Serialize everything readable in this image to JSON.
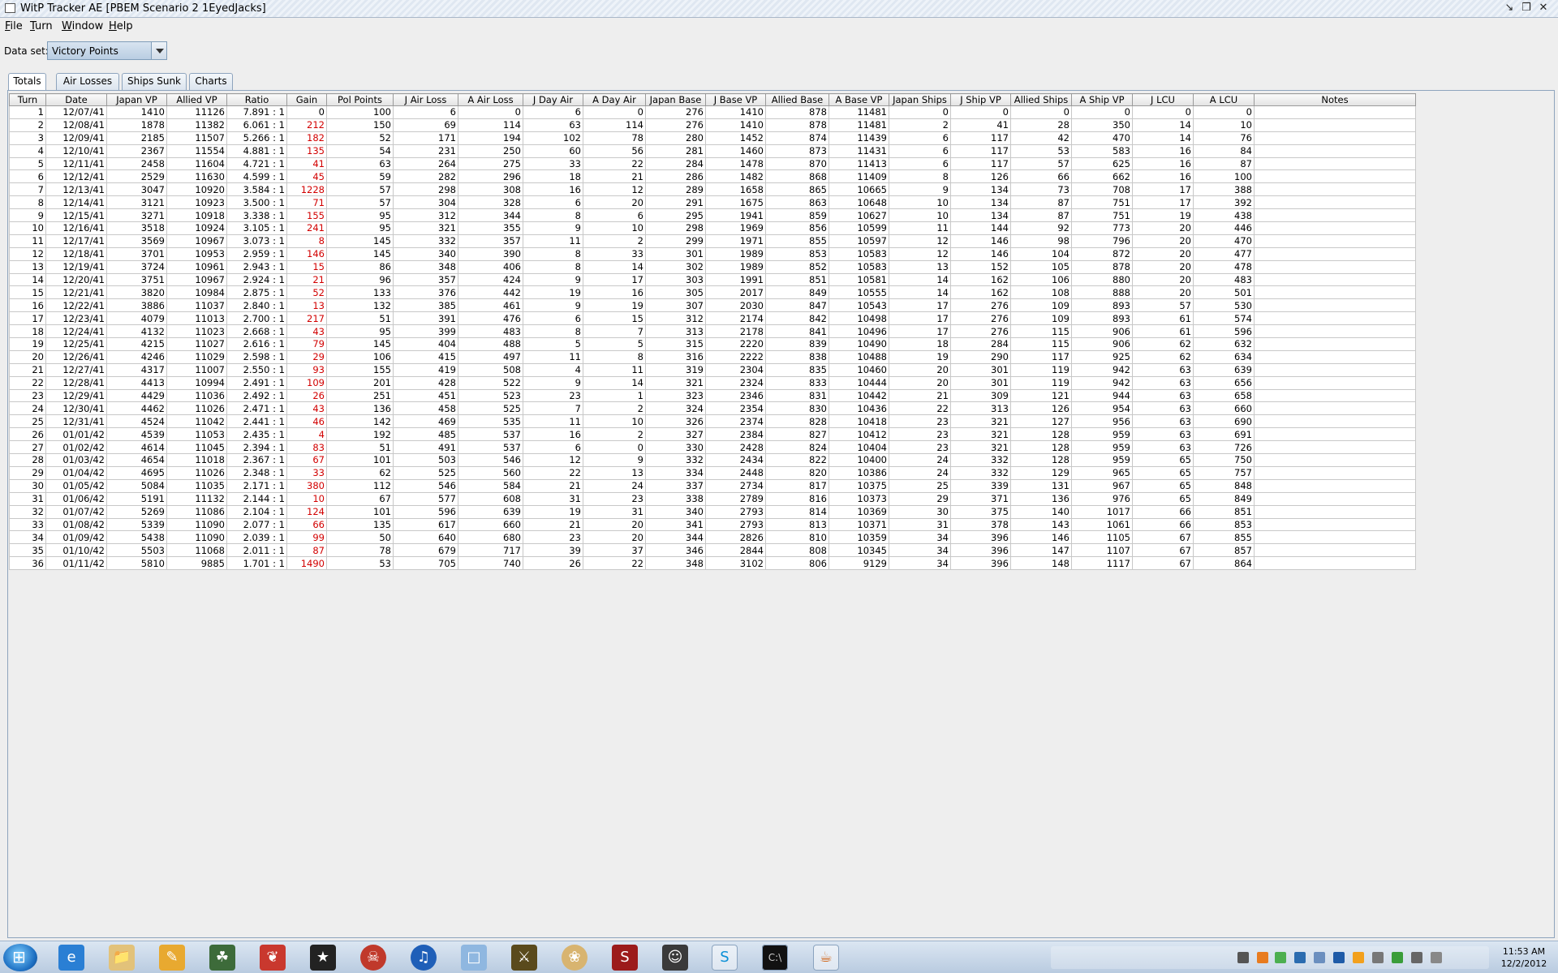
{
  "window": {
    "title": "WitP Tracker AE [PBEM Scenario 2 1EyedJacks]"
  },
  "menu": [
    {
      "hot": "F",
      "rest": "ile"
    },
    {
      "hot": "T",
      "rest": "urn"
    },
    {
      "hot": "W",
      "rest": "indow"
    },
    {
      "hot": "H",
      "rest": "elp"
    }
  ],
  "dataset": {
    "label": "Data set:",
    "value": "Victory Points"
  },
  "tabs": [
    "Totals",
    "Air Losses",
    "Ships Sunk",
    "Charts"
  ],
  "active_tab": "Totals",
  "table": {
    "columns": [
      "Turn",
      "Date",
      "Japan VP",
      "Allied VP",
      "Ratio",
      "Gain",
      "Pol Points",
      "J Air Loss",
      "A Air Loss",
      "J Day Air",
      "A Day Air",
      "Japan Base",
      "J Base VP",
      "Allied Base",
      "A Base VP",
      "Japan Ships",
      "J Ship VP",
      "Allied Ships",
      "A Ship VP",
      "J LCU",
      "A LCU",
      "Notes"
    ],
    "rows": [
      [
        "1",
        "12/07/41",
        "1410",
        "11126",
        "7.891 : 1",
        "0",
        "100",
        "6",
        "0",
        "6",
        "0",
        "276",
        "1410",
        "878",
        "11481",
        "0",
        "0",
        "0",
        "0",
        "0",
        "0",
        ""
      ],
      [
        "2",
        "12/08/41",
        "1878",
        "11382",
        "6.061 : 1",
        "212",
        "150",
        "69",
        "114",
        "63",
        "114",
        "276",
        "1410",
        "878",
        "11481",
        "2",
        "41",
        "28",
        "350",
        "14",
        "10",
        ""
      ],
      [
        "3",
        "12/09/41",
        "2185",
        "11507",
        "5.266 : 1",
        "182",
        "52",
        "171",
        "194",
        "102",
        "78",
        "280",
        "1452",
        "874",
        "11439",
        "6",
        "117",
        "42",
        "470",
        "14",
        "76",
        ""
      ],
      [
        "4",
        "12/10/41",
        "2367",
        "11554",
        "4.881 : 1",
        "135",
        "54",
        "231",
        "250",
        "60",
        "56",
        "281",
        "1460",
        "873",
        "11431",
        "6",
        "117",
        "53",
        "583",
        "16",
        "84",
        ""
      ],
      [
        "5",
        "12/11/41",
        "2458",
        "11604",
        "4.721 : 1",
        "41",
        "63",
        "264",
        "275",
        "33",
        "22",
        "284",
        "1478",
        "870",
        "11413",
        "6",
        "117",
        "57",
        "625",
        "16",
        "87",
        ""
      ],
      [
        "6",
        "12/12/41",
        "2529",
        "11630",
        "4.599 : 1",
        "45",
        "59",
        "282",
        "296",
        "18",
        "21",
        "286",
        "1482",
        "868",
        "11409",
        "8",
        "126",
        "66",
        "662",
        "16",
        "100",
        ""
      ],
      [
        "7",
        "12/13/41",
        "3047",
        "10920",
        "3.584 : 1",
        "1228",
        "57",
        "298",
        "308",
        "16",
        "12",
        "289",
        "1658",
        "865",
        "10665",
        "9",
        "134",
        "73",
        "708",
        "17",
        "388",
        ""
      ],
      [
        "8",
        "12/14/41",
        "3121",
        "10923",
        "3.500 : 1",
        "71",
        "57",
        "304",
        "328",
        "6",
        "20",
        "291",
        "1675",
        "863",
        "10648",
        "10",
        "134",
        "87",
        "751",
        "17",
        "392",
        ""
      ],
      [
        "9",
        "12/15/41",
        "3271",
        "10918",
        "3.338 : 1",
        "155",
        "95",
        "312",
        "344",
        "8",
        "6",
        "295",
        "1941",
        "859",
        "10627",
        "10",
        "134",
        "87",
        "751",
        "19",
        "438",
        ""
      ],
      [
        "10",
        "12/16/41",
        "3518",
        "10924",
        "3.105 : 1",
        "241",
        "95",
        "321",
        "355",
        "9",
        "10",
        "298",
        "1969",
        "856",
        "10599",
        "11",
        "144",
        "92",
        "773",
        "20",
        "446",
        ""
      ],
      [
        "11",
        "12/17/41",
        "3569",
        "10967",
        "3.073 : 1",
        "8",
        "145",
        "332",
        "357",
        "11",
        "2",
        "299",
        "1971",
        "855",
        "10597",
        "12",
        "146",
        "98",
        "796",
        "20",
        "470",
        ""
      ],
      [
        "12",
        "12/18/41",
        "3701",
        "10953",
        "2.959 : 1",
        "146",
        "145",
        "340",
        "390",
        "8",
        "33",
        "301",
        "1989",
        "853",
        "10583",
        "12",
        "146",
        "104",
        "872",
        "20",
        "477",
        ""
      ],
      [
        "13",
        "12/19/41",
        "3724",
        "10961",
        "2.943 : 1",
        "15",
        "86",
        "348",
        "406",
        "8",
        "14",
        "302",
        "1989",
        "852",
        "10583",
        "13",
        "152",
        "105",
        "878",
        "20",
        "478",
        ""
      ],
      [
        "14",
        "12/20/41",
        "3751",
        "10967",
        "2.924 : 1",
        "21",
        "96",
        "357",
        "424",
        "9",
        "17",
        "303",
        "1991",
        "851",
        "10581",
        "14",
        "162",
        "106",
        "880",
        "20",
        "483",
        ""
      ],
      [
        "15",
        "12/21/41",
        "3820",
        "10984",
        "2.875 : 1",
        "52",
        "133",
        "376",
        "442",
        "19",
        "16",
        "305",
        "2017",
        "849",
        "10555",
        "14",
        "162",
        "108",
        "888",
        "20",
        "501",
        ""
      ],
      [
        "16",
        "12/22/41",
        "3886",
        "11037",
        "2.840 : 1",
        "13",
        "132",
        "385",
        "461",
        "9",
        "19",
        "307",
        "2030",
        "847",
        "10543",
        "17",
        "276",
        "109",
        "893",
        "57",
        "530",
        ""
      ],
      [
        "17",
        "12/23/41",
        "4079",
        "11013",
        "2.700 : 1",
        "217",
        "51",
        "391",
        "476",
        "6",
        "15",
        "312",
        "2174",
        "842",
        "10498",
        "17",
        "276",
        "109",
        "893",
        "61",
        "574",
        ""
      ],
      [
        "18",
        "12/24/41",
        "4132",
        "11023",
        "2.668 : 1",
        "43",
        "95",
        "399",
        "483",
        "8",
        "7",
        "313",
        "2178",
        "841",
        "10496",
        "17",
        "276",
        "115",
        "906",
        "61",
        "596",
        ""
      ],
      [
        "19",
        "12/25/41",
        "4215",
        "11027",
        "2.616 : 1",
        "79",
        "145",
        "404",
        "488",
        "5",
        "5",
        "315",
        "2220",
        "839",
        "10490",
        "18",
        "284",
        "115",
        "906",
        "62",
        "632",
        ""
      ],
      [
        "20",
        "12/26/41",
        "4246",
        "11029",
        "2.598 : 1",
        "29",
        "106",
        "415",
        "497",
        "11",
        "8",
        "316",
        "2222",
        "838",
        "10488",
        "19",
        "290",
        "117",
        "925",
        "62",
        "634",
        ""
      ],
      [
        "21",
        "12/27/41",
        "4317",
        "11007",
        "2.550 : 1",
        "93",
        "155",
        "419",
        "508",
        "4",
        "11",
        "319",
        "2304",
        "835",
        "10460",
        "20",
        "301",
        "119",
        "942",
        "63",
        "639",
        ""
      ],
      [
        "22",
        "12/28/41",
        "4413",
        "10994",
        "2.491 : 1",
        "109",
        "201",
        "428",
        "522",
        "9",
        "14",
        "321",
        "2324",
        "833",
        "10444",
        "20",
        "301",
        "119",
        "942",
        "63",
        "656",
        ""
      ],
      [
        "23",
        "12/29/41",
        "4429",
        "11036",
        "2.492 : 1",
        "26",
        "251",
        "451",
        "523",
        "23",
        "1",
        "323",
        "2346",
        "831",
        "10442",
        "21",
        "309",
        "121",
        "944",
        "63",
        "658",
        ""
      ],
      [
        "24",
        "12/30/41",
        "4462",
        "11026",
        "2.471 : 1",
        "43",
        "136",
        "458",
        "525",
        "7",
        "2",
        "324",
        "2354",
        "830",
        "10436",
        "22",
        "313",
        "126",
        "954",
        "63",
        "660",
        ""
      ],
      [
        "25",
        "12/31/41",
        "4524",
        "11042",
        "2.441 : 1",
        "46",
        "142",
        "469",
        "535",
        "11",
        "10",
        "326",
        "2374",
        "828",
        "10418",
        "23",
        "321",
        "127",
        "956",
        "63",
        "690",
        ""
      ],
      [
        "26",
        "01/01/42",
        "4539",
        "11053",
        "2.435 : 1",
        "4",
        "192",
        "485",
        "537",
        "16",
        "2",
        "327",
        "2384",
        "827",
        "10412",
        "23",
        "321",
        "128",
        "959",
        "63",
        "691",
        ""
      ],
      [
        "27",
        "01/02/42",
        "4614",
        "11045",
        "2.394 : 1",
        "83",
        "51",
        "491",
        "537",
        "6",
        "0",
        "330",
        "2428",
        "824",
        "10404",
        "23",
        "321",
        "128",
        "959",
        "63",
        "726",
        ""
      ],
      [
        "28",
        "01/03/42",
        "4654",
        "11018",
        "2.367 : 1",
        "67",
        "101",
        "503",
        "546",
        "12",
        "9",
        "332",
        "2434",
        "822",
        "10400",
        "24",
        "332",
        "128",
        "959",
        "65",
        "750",
        ""
      ],
      [
        "29",
        "01/04/42",
        "4695",
        "11026",
        "2.348 : 1",
        "33",
        "62",
        "525",
        "560",
        "22",
        "13",
        "334",
        "2448",
        "820",
        "10386",
        "24",
        "332",
        "129",
        "965",
        "65",
        "757",
        ""
      ],
      [
        "30",
        "01/05/42",
        "5084",
        "11035",
        "2.171 : 1",
        "380",
        "112",
        "546",
        "584",
        "21",
        "24",
        "337",
        "2734",
        "817",
        "10375",
        "25",
        "339",
        "131",
        "967",
        "65",
        "848",
        ""
      ],
      [
        "31",
        "01/06/42",
        "5191",
        "11132",
        "2.144 : 1",
        "10",
        "67",
        "577",
        "608",
        "31",
        "23",
        "338",
        "2789",
        "816",
        "10373",
        "29",
        "371",
        "136",
        "976",
        "65",
        "849",
        ""
      ],
      [
        "32",
        "01/07/42",
        "5269",
        "11086",
        "2.104 : 1",
        "124",
        "101",
        "596",
        "639",
        "19",
        "31",
        "340",
        "2793",
        "814",
        "10369",
        "30",
        "375",
        "140",
        "1017",
        "66",
        "851",
        ""
      ],
      [
        "33",
        "01/08/42",
        "5339",
        "11090",
        "2.077 : 1",
        "66",
        "135",
        "617",
        "660",
        "21",
        "20",
        "341",
        "2793",
        "813",
        "10371",
        "31",
        "378",
        "143",
        "1061",
        "66",
        "853",
        ""
      ],
      [
        "34",
        "01/09/42",
        "5438",
        "11090",
        "2.039 : 1",
        "99",
        "50",
        "640",
        "680",
        "23",
        "20",
        "344",
        "2826",
        "810",
        "10359",
        "34",
        "396",
        "146",
        "1105",
        "67",
        "855",
        ""
      ],
      [
        "35",
        "01/10/42",
        "5503",
        "11068",
        "2.011 : 1",
        "87",
        "78",
        "679",
        "717",
        "39",
        "37",
        "346",
        "2844",
        "808",
        "10345",
        "34",
        "396",
        "147",
        "1107",
        "67",
        "857",
        ""
      ],
      [
        "36",
        "01/11/42",
        "5810",
        "9885",
        "1.701 : 1",
        "1490",
        "53",
        "705",
        "740",
        "26",
        "22",
        "348",
        "3102",
        "806",
        "9129",
        "34",
        "396",
        "148",
        "1117",
        "67",
        "864",
        ""
      ]
    ]
  },
  "taskbar": {
    "icons": [
      "windows-start-icon",
      "internet-explorer-icon",
      "explorer-folder-icon",
      "notes-app-icon",
      "game-icon-1",
      "parrot-app-icon",
      "military-rank-icon",
      "game-icon-2",
      "itunes-icon",
      "notepad-icon",
      "game-icon-3",
      "paint-icon",
      "sins-game-icon",
      "general-portrait-icon",
      "skype-icon",
      "command-prompt-icon",
      "java-icon"
    ],
    "clock_time": "11:53 AM",
    "clock_date": "12/2/2012"
  },
  "colors": {
    "gain_text": "#d20000",
    "tab_border": "#8ea4bd",
    "title_stripe": "#dfe7f1"
  }
}
